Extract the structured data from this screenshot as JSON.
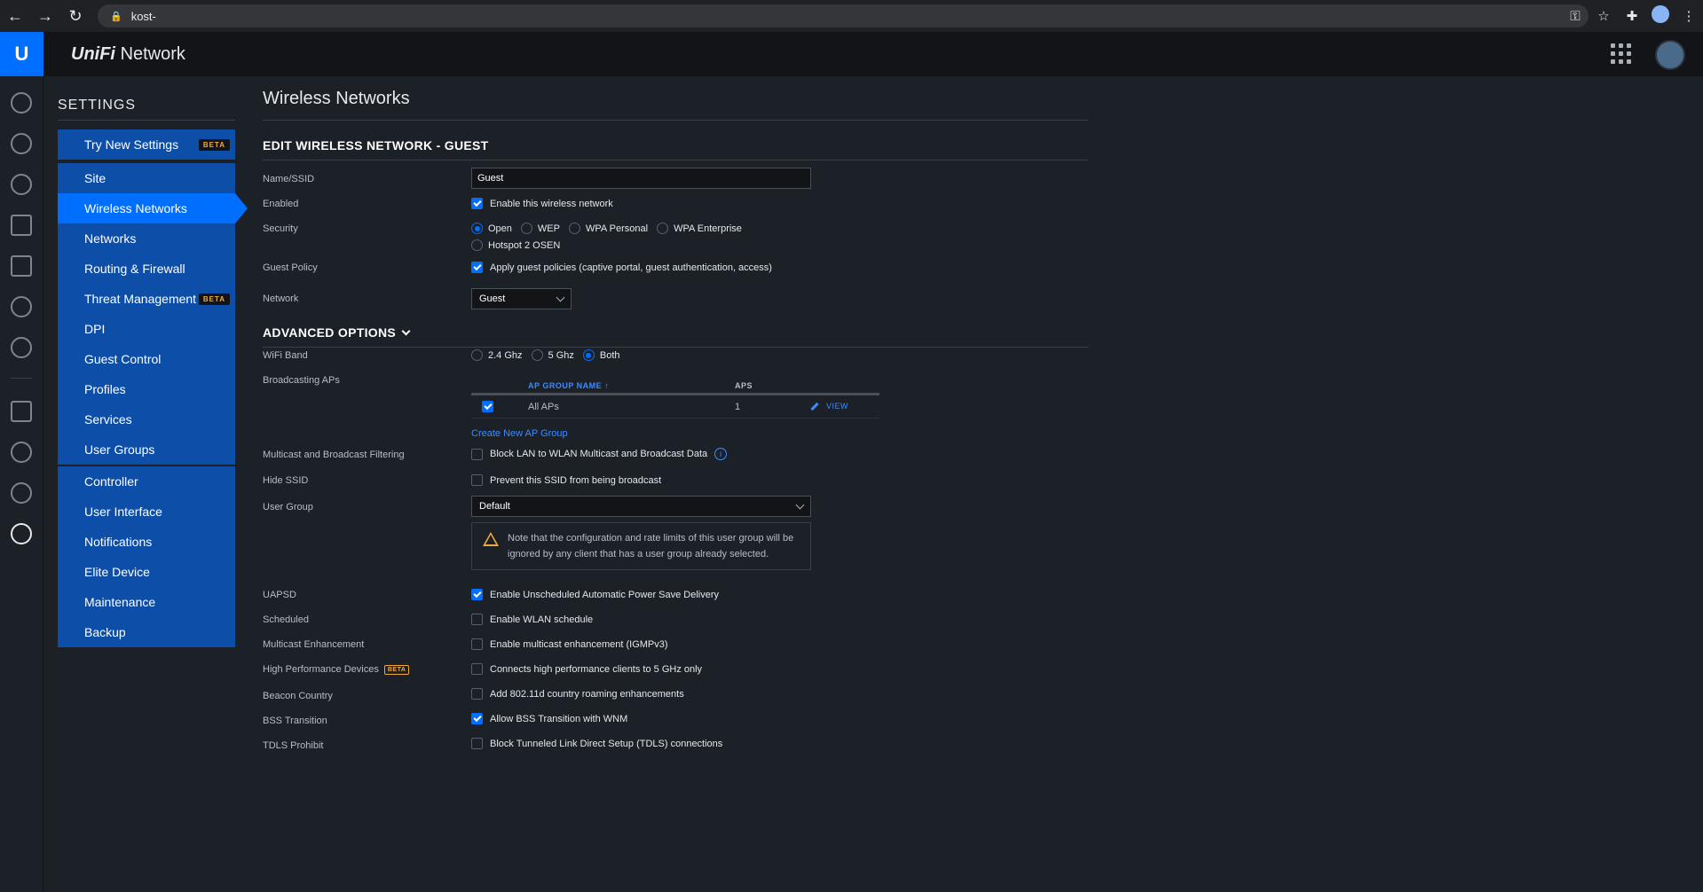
{
  "browser": {
    "url": "kost-",
    "back_icon": "arrow-left-icon",
    "forward_icon": "arrow-right-icon",
    "reload_icon": "reload-icon"
  },
  "app": {
    "brand_prefix": "UniFi",
    "brand_suffix": "Network",
    "logo_letter": "U"
  },
  "settings": {
    "heading": "SETTINGS",
    "groups": [
      [
        {
          "label": "Try New Settings",
          "badge": "BETA"
        }
      ],
      [
        {
          "label": "Site"
        },
        {
          "label": "Wireless Networks",
          "active": true
        },
        {
          "label": "Networks"
        },
        {
          "label": "Routing & Firewall"
        },
        {
          "label": "Threat Management",
          "badge": "BETA"
        },
        {
          "label": "DPI"
        },
        {
          "label": "Guest Control"
        },
        {
          "label": "Profiles"
        },
        {
          "label": "Services"
        },
        {
          "label": "User Groups"
        }
      ],
      [
        {
          "label": "Controller"
        },
        {
          "label": "User Interface"
        },
        {
          "label": "Notifications"
        },
        {
          "label": "Elite Device"
        },
        {
          "label": "Maintenance"
        },
        {
          "label": "Backup"
        }
      ]
    ]
  },
  "main": {
    "title": "Wireless Networks",
    "edit_heading": "EDIT WIRELESS NETWORK - GUEST",
    "name_label": "Name/SSID",
    "name_value": "Guest",
    "enabled_label": "Enabled",
    "enabled_text": "Enable this wireless network",
    "security_label": "Security",
    "security_options": [
      "Open",
      "WEP",
      "WPA Personal",
      "WPA Enterprise",
      "Hotspot 2 OSEN"
    ],
    "security_selected": "Open",
    "guest_policy_label": "Guest Policy",
    "guest_policy_text": "Apply guest policies (captive portal, guest authentication, access)",
    "network_label": "Network",
    "network_value": "Guest",
    "advanced_heading": "ADVANCED OPTIONS",
    "wifi_band_label": "WiFi Band",
    "wifi_band_options": [
      "2.4 Ghz",
      "5 Ghz",
      "Both"
    ],
    "wifi_band_selected": "Both",
    "broadcasting_label": "Broadcasting APs",
    "ap_table": {
      "col_name": "AP GROUP NAME",
      "col_aps": "APS",
      "row_name": "All APs",
      "row_aps": "1",
      "view_label": "VIEW"
    },
    "create_ap_group": "Create New AP Group",
    "multicast_label": "Multicast and Broadcast Filtering",
    "multicast_text": "Block LAN to WLAN Multicast and Broadcast Data",
    "hide_ssid_label": "Hide SSID",
    "hide_ssid_text": "Prevent this SSID from being broadcast",
    "user_group_label": "User Group",
    "user_group_value": "Default",
    "note_text": "Note that the configuration and rate limits of this user group will be ignored by any client that has a user group already selected.",
    "uapsd_label": "UAPSD",
    "uapsd_text": "Enable Unscheduled Automatic Power Save Delivery",
    "scheduled_label": "Scheduled",
    "scheduled_text": "Enable WLAN schedule",
    "mc_enh_label": "Multicast Enhancement",
    "mc_enh_text": "Enable multicast enhancement (IGMPv3)",
    "hpd_label": "High Performance Devices",
    "hpd_badge": "BETA",
    "hpd_text": "Connects high performance clients to 5 GHz only",
    "beacon_label": "Beacon Country",
    "beacon_text": "Add 802.11d country roaming enhancements",
    "bss_label": "BSS Transition",
    "bss_text": "Allow BSS Transition with WNM",
    "tdls_label": "TDLS Prohibit",
    "tdls_text": "Block Tunneled Link Direct Setup (TDLS) connections"
  },
  "colors": {
    "accent": "#006fff",
    "sidebar": "#0d4ea8",
    "background": "#1c2027",
    "warning": "#f2a93b"
  }
}
